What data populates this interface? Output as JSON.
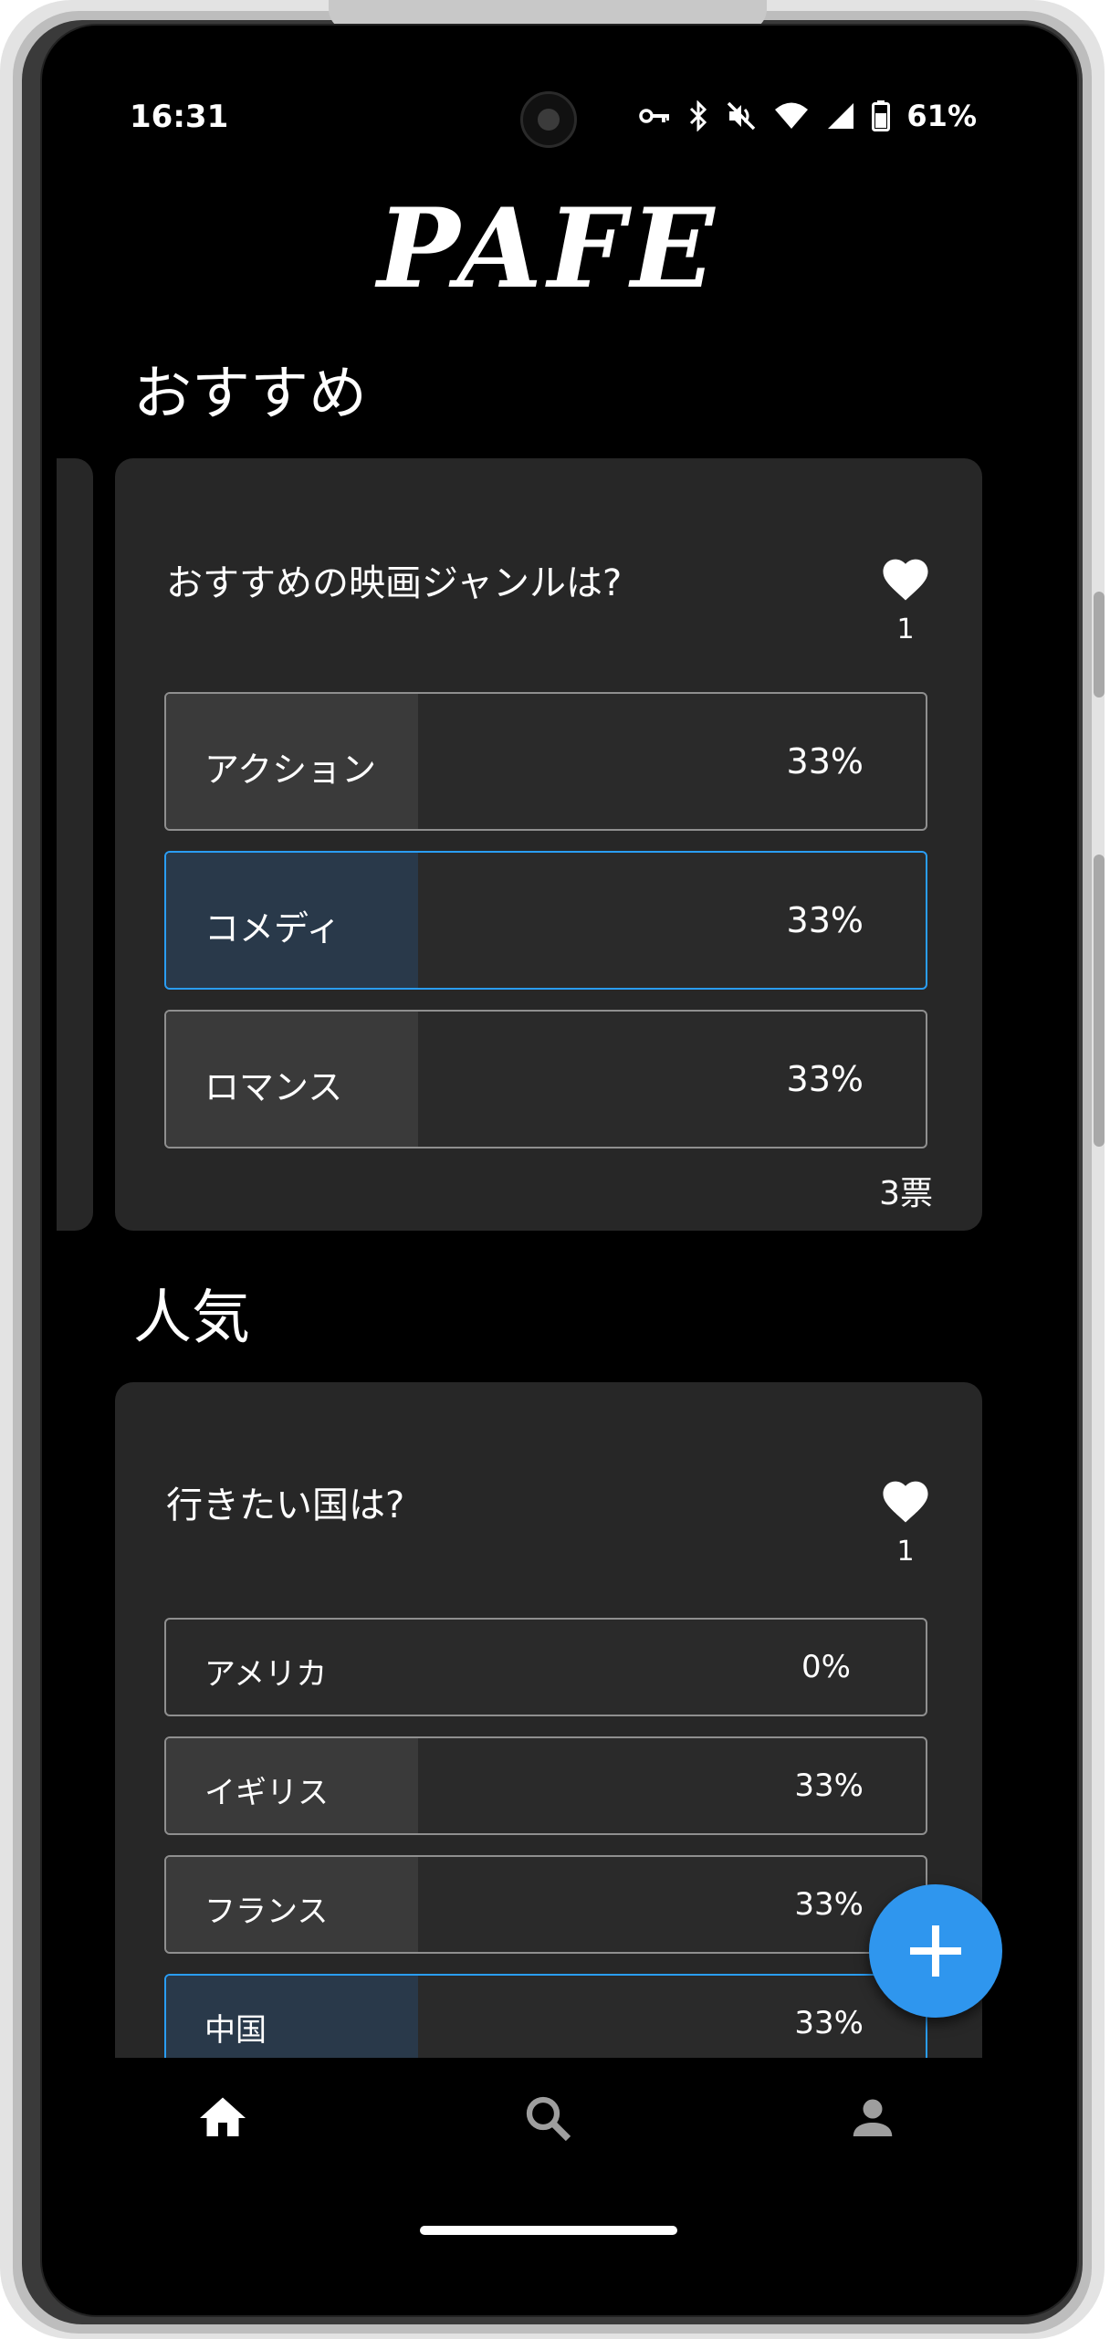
{
  "status_bar": {
    "time": "16:31",
    "battery": "61%",
    "icons": [
      "vpn-key-icon",
      "bluetooth-icon",
      "mute-icon",
      "wifi-icon",
      "signal-icon",
      "battery-icon"
    ]
  },
  "app": {
    "logo": "PAFE"
  },
  "recommended": {
    "title": "おすすめ",
    "card": {
      "question": "おすすめの映画ジャンルは?",
      "likes": "1",
      "options": [
        {
          "label": "アクション",
          "percent": "33%",
          "share": 0.33,
          "selected": false
        },
        {
          "label": "コメディ",
          "percent": "33%",
          "share": 0.33,
          "selected": true
        },
        {
          "label": "ロマンス",
          "percent": "33%",
          "share": 0.33,
          "selected": false
        }
      ],
      "votes": "3票"
    }
  },
  "popular": {
    "title": "人気",
    "card": {
      "question": "行きたい国は?",
      "likes": "1",
      "options": [
        {
          "label": "アメリカ",
          "percent": "0%",
          "share": 0,
          "selected": false
        },
        {
          "label": "イギリス",
          "percent": "33%",
          "share": 0.33,
          "selected": false
        },
        {
          "label": "フランス",
          "percent": "33%",
          "share": 0.33,
          "selected": false
        },
        {
          "label": "中国",
          "percent": "33%",
          "share": 0.33,
          "selected": true
        }
      ]
    }
  },
  "bottom_nav": {
    "items": [
      {
        "icon": "home-icon",
        "active": true
      },
      {
        "icon": "search-icon",
        "active": false
      },
      {
        "icon": "person-icon",
        "active": false
      }
    ]
  },
  "colors": {
    "accent": "#2f96ee",
    "selected_border": "#2a9df4",
    "card_bg": "#272727",
    "fill": "#3a3a3a",
    "selected_fill": "#29394a"
  }
}
